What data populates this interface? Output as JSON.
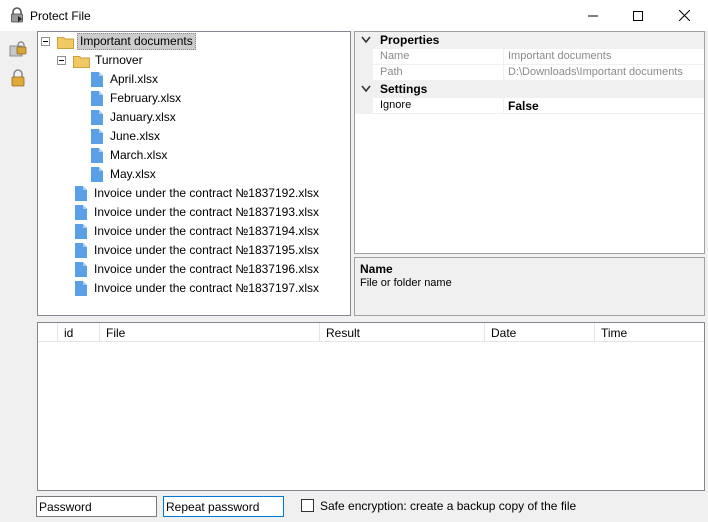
{
  "window": {
    "title": "Protect File"
  },
  "tree": {
    "root": {
      "label": "Important documents"
    },
    "folder": {
      "label": "Turnover"
    },
    "folder_files": [
      "April.xlsx",
      "February.xlsx",
      "January.xlsx",
      "June.xlsx",
      "March.xlsx",
      "May.xlsx"
    ],
    "root_files": [
      "Invoice under the contract №1837192.xlsx",
      "Invoice under the contract №1837193.xlsx",
      "Invoice under the contract №1837194.xlsx",
      "Invoice under the contract №1837195.xlsx",
      "Invoice under the contract №1837196.xlsx",
      "Invoice under the contract №1837197.xlsx"
    ]
  },
  "properties": {
    "categories": [
      {
        "label": "Properties"
      },
      {
        "label": "Settings"
      }
    ],
    "rows": [
      {
        "name": "Name",
        "value": "Important documents"
      },
      {
        "name": "Path",
        "value": "D:\\Downloads\\Important documents"
      },
      {
        "name": "Ignore",
        "value": "False"
      }
    ]
  },
  "description": {
    "title": "Name",
    "text": "File or folder name"
  },
  "log": {
    "columns": [
      "id",
      "File",
      "Result",
      "Date",
      "Time"
    ]
  },
  "inputs": {
    "password_placeholder": "Password",
    "repeat_placeholder": "Repeat password"
  },
  "options": {
    "safe_encryption_label": "Safe encryption: create a backup copy of the file",
    "safe_encryption_checked": false
  },
  "colors": {
    "folder": "#f0c864",
    "file": "#5aa0e6",
    "focus_border": "#0078d7"
  }
}
